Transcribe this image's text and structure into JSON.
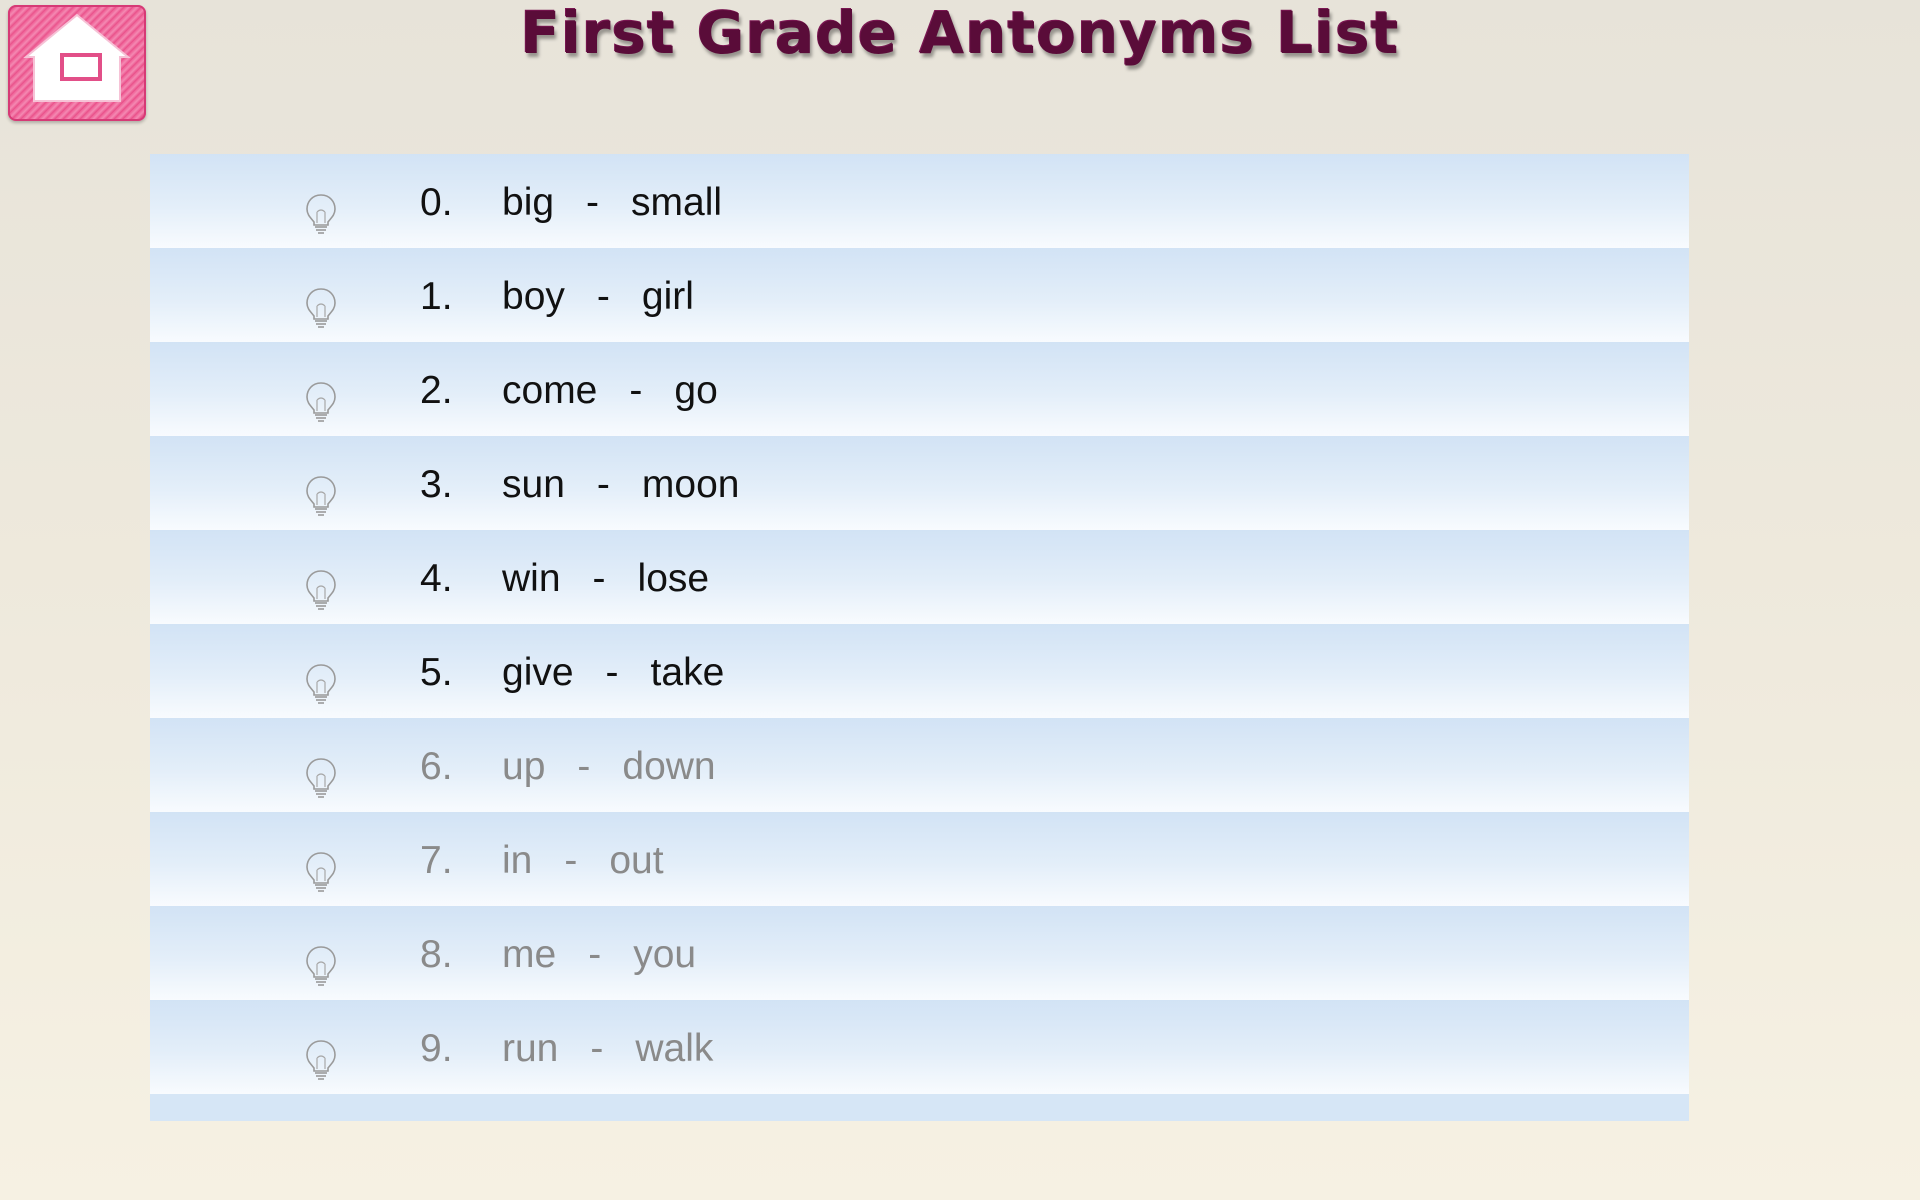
{
  "header": {
    "title": "First Grade Antonyms List",
    "home_icon": "home-icon"
  },
  "colors": {
    "title": "#5a0c39",
    "home_button": "#ee5c93",
    "row_top": "#d2e3f5",
    "row_bottom": "#f8fbfe",
    "active_text": "#111111",
    "inactive_text": "#8a8a8a"
  },
  "list": {
    "row_icon": "lightbulb-icon",
    "separator": "-",
    "items": [
      {
        "number": "0.",
        "word": "big",
        "antonym": "small",
        "state": "active"
      },
      {
        "number": "1.",
        "word": "boy",
        "antonym": "girl",
        "state": "active"
      },
      {
        "number": "2.",
        "word": "come",
        "antonym": "go",
        "state": "active"
      },
      {
        "number": "3.",
        "word": "sun",
        "antonym": "moon",
        "state": "active"
      },
      {
        "number": "4.",
        "word": "win",
        "antonym": "lose",
        "state": "active"
      },
      {
        "number": "5.",
        "word": "give",
        "antonym": "take",
        "state": "active"
      },
      {
        "number": "6.",
        "word": "up",
        "antonym": "down",
        "state": "inactive"
      },
      {
        "number": "7.",
        "word": "in",
        "antonym": "out",
        "state": "inactive"
      },
      {
        "number": "8.",
        "word": "me",
        "antonym": "you",
        "state": "inactive"
      },
      {
        "number": "9.",
        "word": "run",
        "antonym": "walk",
        "state": "inactive"
      }
    ]
  }
}
